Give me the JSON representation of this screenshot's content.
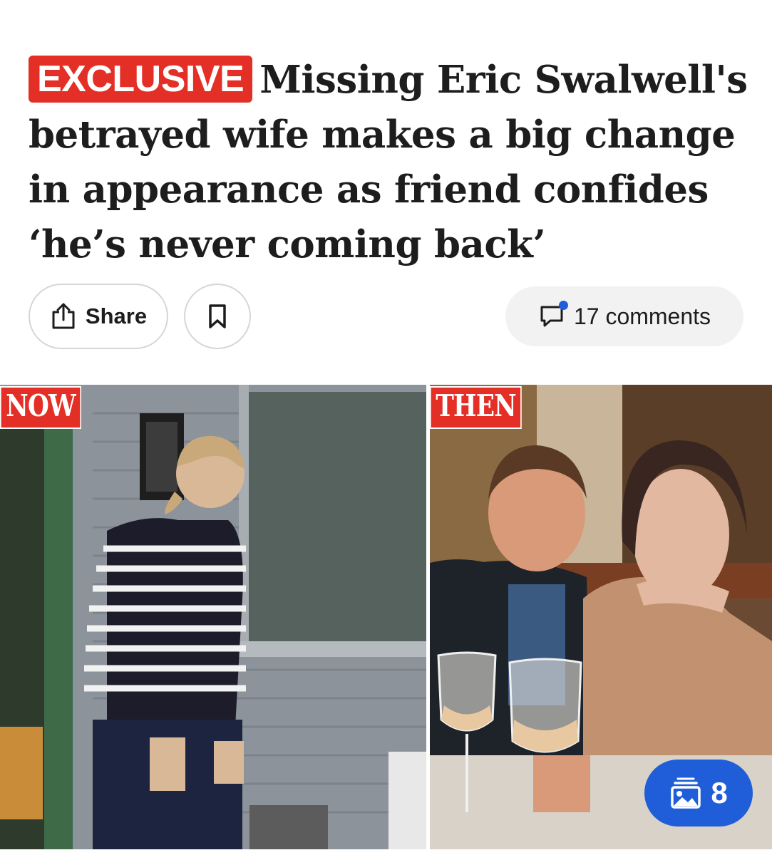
{
  "article": {
    "tag": "EXCLUSIVE",
    "headline": "Missing Eric Swalwell's betrayed wife makes a big change in appearance as friend confides ‘he’s never coming back’"
  },
  "actions": {
    "share_label": "Share",
    "comments_label": "17 comments"
  },
  "photos": {
    "left_label": "NOW",
    "right_label": "THEN"
  },
  "gallery": {
    "count": "8"
  },
  "colors": {
    "tag_red": "#e42f26",
    "accent_blue": "#1f5ed8"
  },
  "icons": [
    "share-icon",
    "bookmark-icon",
    "comment-icon",
    "gallery-icon"
  ]
}
